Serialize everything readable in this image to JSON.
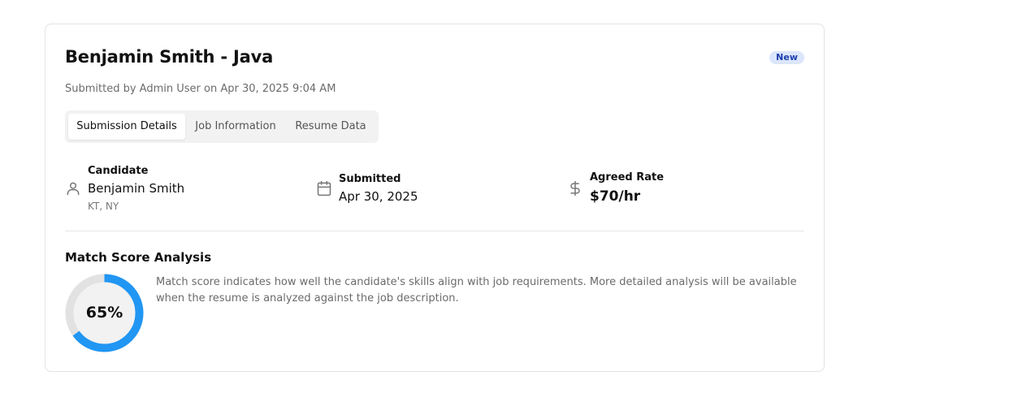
{
  "card": {
    "title": "Benjamin Smith - Java",
    "badge": "New",
    "subtitle": "Submitted by Admin User on Apr 30, 2025 9:04 AM"
  },
  "tabs": [
    {
      "label": "Submission Details",
      "active": true
    },
    {
      "label": "Job Information",
      "active": false
    },
    {
      "label": "Resume Data",
      "active": false
    }
  ],
  "details": {
    "candidate": {
      "label": "Candidate",
      "name": "Benjamin Smith",
      "location": "KT, NY",
      "icon": "user-icon"
    },
    "submitted": {
      "label": "Submitted",
      "date": "Apr 30, 2025",
      "icon": "calendar-icon"
    },
    "rate": {
      "label": "Agreed Rate",
      "value": "$70/hr",
      "icon": "dollar-icon"
    }
  },
  "match": {
    "title": "Match Score Analysis",
    "score": 65,
    "score_label": "65%",
    "description": "Match score indicates how well the candidate's skills align with job requirements. More detailed analysis will be available when the resume is analyzed against the job description."
  },
  "colors": {
    "accent": "#2196f3",
    "ring_track": "#e2e2e2",
    "badge_bg": "#dbe6fb",
    "badge_text": "#1e40af"
  }
}
